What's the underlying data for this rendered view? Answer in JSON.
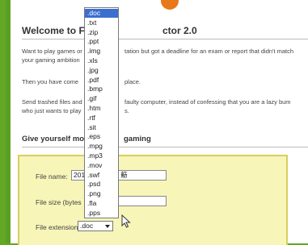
{
  "page": {
    "title": "Welcome to Fi",
    "title_hidden_tail": "ctor 2.0",
    "para1_line1_left": "Want to play games or",
    "para1_line1_right": "tation but got a deadline for an exam or report that didn't match",
    "para1_line2": "your gaming ambition",
    "para2_left": "Then you have come",
    "para2_right": "place.",
    "para3_line1_left": "Send trashed files and",
    "para3_line1_right": "faulty computer, instead of confessing that you are a lazy bum",
    "para3_line2_left": "who just wants to play",
    "para3_line2_right": "s.",
    "section_title_left": "Give yourself more",
    "section_title_right": "gaming"
  },
  "form": {
    "file_name_label": "File name:",
    "file_name_value": "201",
    "file_name_value_tail": "䈥",
    "file_size_label": "File size (bytes",
    "file_size_value": "",
    "file_extension_label": "File extension:",
    "file_extension_value": ".doc"
  },
  "dropdown": {
    "selected_index": 0,
    "options": [
      ".doc",
      ".txt",
      ".zip",
      ".ppt",
      ".img",
      ".xls",
      ".jpg",
      ".pdf",
      ".bmp",
      ".gif",
      ".htm",
      ".rtf",
      ".sit",
      ".eps",
      ".mpg",
      ".mp3",
      ".mov",
      ".swf",
      ".psd",
      ".png",
      ".fla",
      ".pps"
    ]
  },
  "colors": {
    "background_green": "#63a825",
    "form_panel_fill": "#f7f5b8",
    "form_panel_border": "#d8cf5c",
    "selection_blue": "#3b6fcf"
  }
}
